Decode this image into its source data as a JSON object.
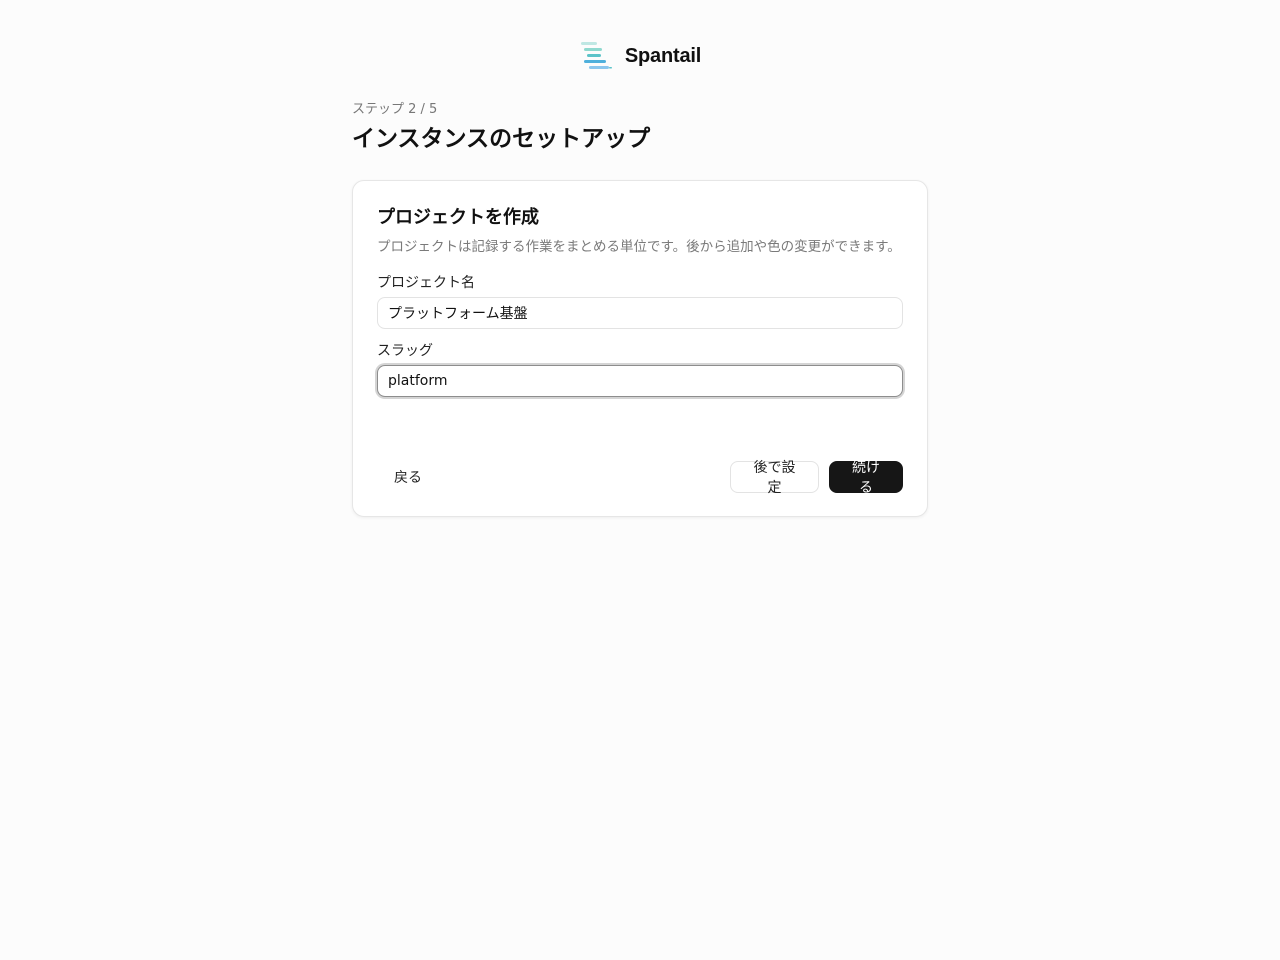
{
  "brand": {
    "name": "Spantail",
    "logo_icon": "stacked-bars-logo-icon",
    "logo_colors": [
      "#bfe7e3",
      "#8fd9cf",
      "#5cc3c9",
      "#4fb0dc",
      "#8bc7ee"
    ]
  },
  "wizard": {
    "step_text": "ステップ 2 / 5",
    "title": "インスタンスのセットアップ"
  },
  "card": {
    "title": "プロジェクトを作成",
    "description": "プロジェクトは記録する作業をまとめる単位です。後から追加や色の変更ができます。",
    "fields": {
      "name": {
        "label": "プロジェクト名",
        "value": "プラットフォーム基盤"
      },
      "slug": {
        "label": "スラッグ",
        "value": "platform"
      }
    }
  },
  "actions": {
    "back_label": "戻る",
    "later_label": "後で設定",
    "continue_label": "続ける"
  },
  "colors": {
    "background": "#fcfcfc",
    "primary_button": "#161616",
    "muted_text": "#7a7a7a"
  }
}
